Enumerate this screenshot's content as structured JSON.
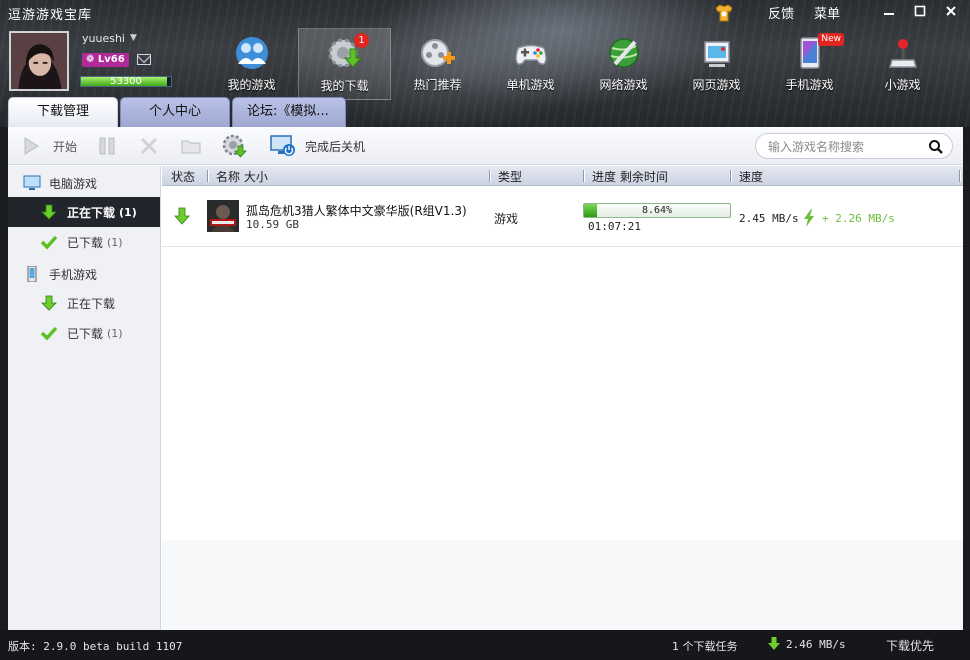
{
  "app": {
    "title": "逗游游戏宝库",
    "links": [
      "反馈",
      "菜单"
    ],
    "window_controls": [
      "minimize-icon",
      "maximize-icon",
      "close-icon"
    ]
  },
  "user": {
    "name": "yuueshi",
    "level": "Lv66",
    "exp": "53300",
    "exp_fraction": 0.95
  },
  "nav": [
    {
      "label": "我的游戏",
      "icon": "people-icon"
    },
    {
      "label": "我的下载",
      "icon": "download-gear-icon",
      "badge": "1",
      "active": true
    },
    {
      "label": "热门推荐",
      "icon": "hot-film-icon"
    },
    {
      "label": "单机游戏",
      "icon": "gamepad-icon"
    },
    {
      "label": "网络游戏",
      "icon": "globe-icon"
    },
    {
      "label": "网页游戏",
      "icon": "web-game-icon"
    },
    {
      "label": "手机游戏",
      "icon": "phone-icon",
      "badge": "New"
    },
    {
      "label": "小游戏",
      "icon": "joystick-icon"
    }
  ],
  "tabs": [
    "下载管理",
    "个人中心",
    "论坛:《模拟..."
  ],
  "toolbar": {
    "start": "开始",
    "shutdown": "完成后关机",
    "search_placeholder": "输入游戏名称搜索"
  },
  "sidebar": {
    "pc_group": "电脑游戏",
    "pc_downloading": "正在下载",
    "pc_downloading_count": "(1)",
    "pc_done": "已下载",
    "pc_done_count": "(1)",
    "mobile_group": "手机游戏",
    "mobile_downloading": "正在下载",
    "mobile_done": "已下载",
    "mobile_done_count": "(1)"
  },
  "columns": {
    "status": "状态",
    "name_size": "名称 大小",
    "type": "类型",
    "progress": "进度 剩余时间",
    "speed": "速度"
  },
  "downloads": [
    {
      "name": "孤岛危机3猎人繁体中文豪华版(R组V1.3)",
      "size": "10.59 GB",
      "type": "游戏",
      "progress_text": "8.64%",
      "progress": 0.0864,
      "remaining": "01:07:21",
      "speed": "2.45 MB/s",
      "boost": "+ 2.26 MB/s"
    }
  ],
  "statusbar": {
    "version": "版本: 2.9.0 beta build 1107",
    "tasks": "1 个下载任务",
    "speed": "2.46 MB/s",
    "priority": "下载优先"
  },
  "colors": {
    "accent_green": "#3aa51c",
    "badge_red": "#e0261e",
    "active_row": "#22262c"
  }
}
